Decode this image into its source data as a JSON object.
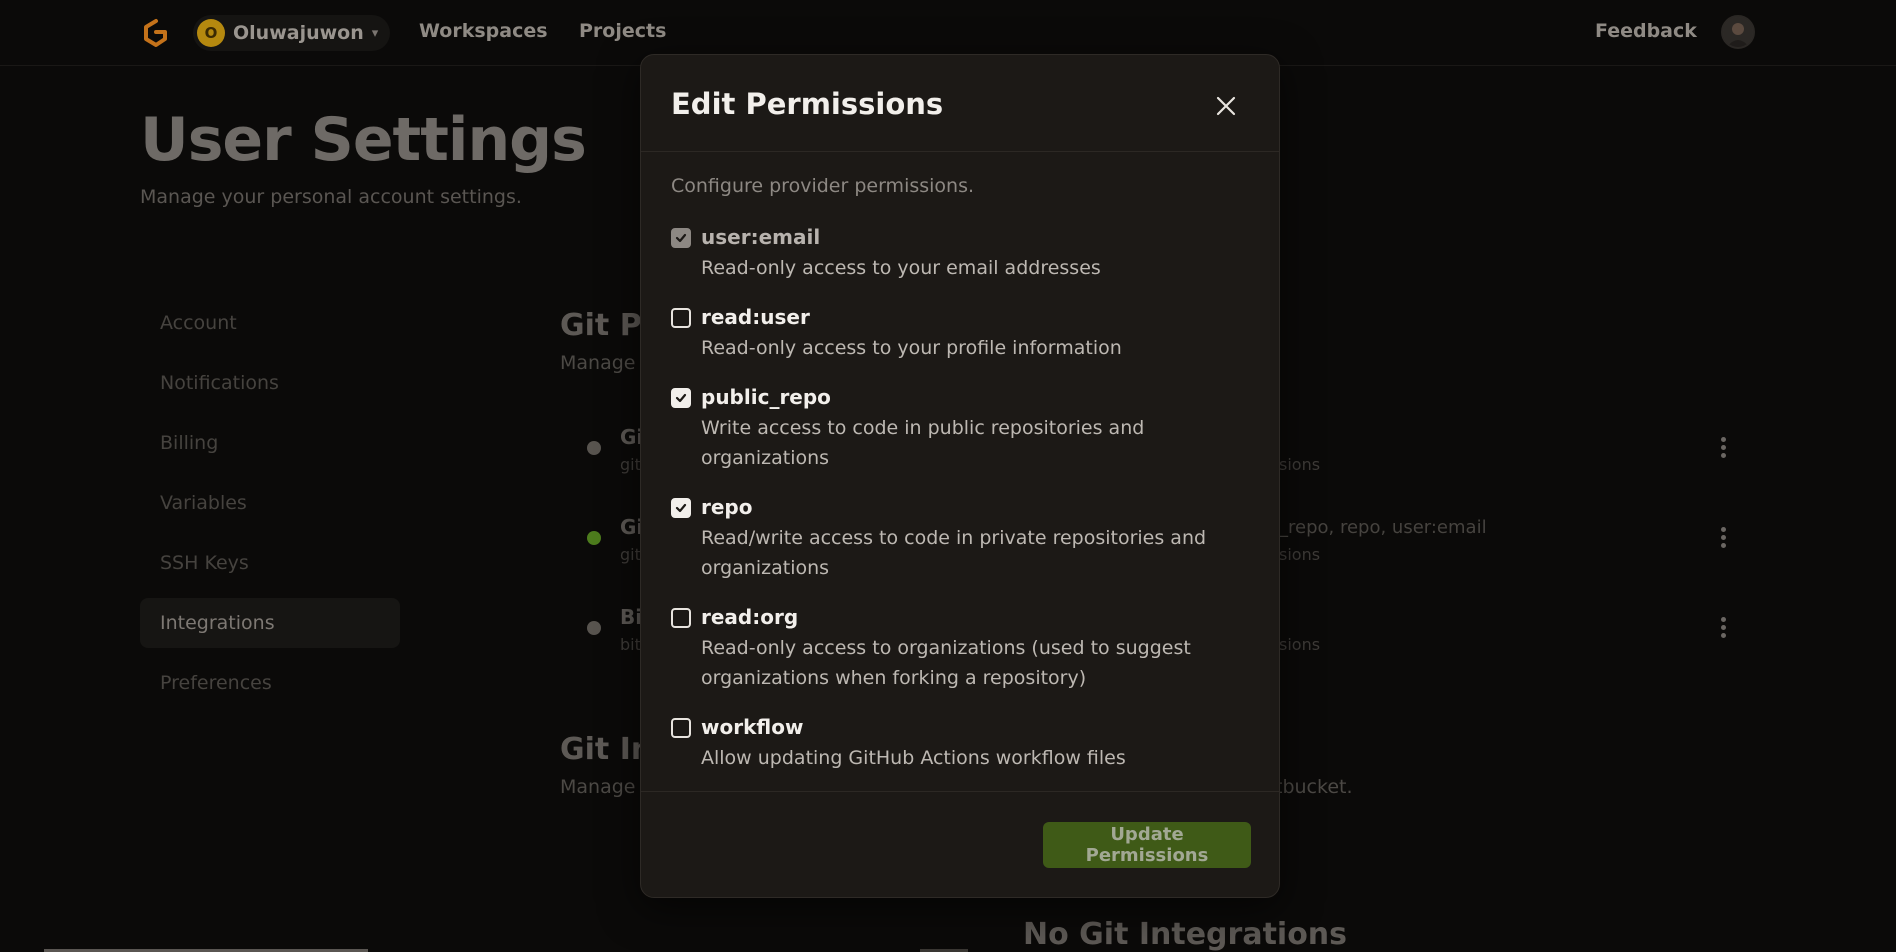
{
  "topbar": {
    "org_initial": "O",
    "org_name": "Oluwajuwon",
    "nav": [
      "Workspaces",
      "Projects"
    ],
    "feedback": "Feedback"
  },
  "page": {
    "title": "User Settings",
    "subtitle": "Manage your personal account settings."
  },
  "sidebar": {
    "items": [
      {
        "label": "Account"
      },
      {
        "label": "Notifications"
      },
      {
        "label": "Billing"
      },
      {
        "label": "Variables"
      },
      {
        "label": "SSH Keys"
      },
      {
        "label": "Integrations"
      },
      {
        "label": "Preferences"
      }
    ],
    "active": "Integrations"
  },
  "background": {
    "section1_title": "Git Pr",
    "section1_sub": "Manage",
    "providers": [
      {
        "label": "Gi",
        "sub": "git",
        "right": "",
        "right_sub": "sions"
      },
      {
        "label": "Gi",
        "sub": "git",
        "right": "_repo, repo, user:email",
        "right_sub": "sions"
      },
      {
        "label": "Bi",
        "sub": "bit",
        "right": "",
        "right_sub": "sions"
      }
    ],
    "section2_title": "Git In",
    "section2_sub": "Manage",
    "section2_sub_right": "tbucket.",
    "empty_title": "No Git Integrations"
  },
  "modal": {
    "title": "Edit Permissions",
    "description": "Configure provider permissions.",
    "permissions": [
      {
        "name": "user:email",
        "description": "Read-only access to your email addresses",
        "checked": true,
        "disabled": true
      },
      {
        "name": "read:user",
        "description": "Read-only access to your profile information",
        "checked": false,
        "disabled": false
      },
      {
        "name": "public_repo",
        "description": "Write access to code in public repositories and organizations",
        "checked": true,
        "disabled": false
      },
      {
        "name": "repo",
        "description": "Read/write access to code in private repositories and organizations",
        "checked": true,
        "disabled": false
      },
      {
        "name": "read:org",
        "description": "Read-only access to organizations (used to suggest organizations when forking a repository)",
        "checked": false,
        "disabled": false
      },
      {
        "name": "workflow",
        "description": "Allow updating GitHub Actions workflow files",
        "checked": false,
        "disabled": false
      }
    ],
    "submit_label": "Update Permissions"
  },
  "colors": {
    "accent_green": "#3f5a17",
    "status_green": "#4d7c1d",
    "modal_bg": "#1c1916"
  }
}
